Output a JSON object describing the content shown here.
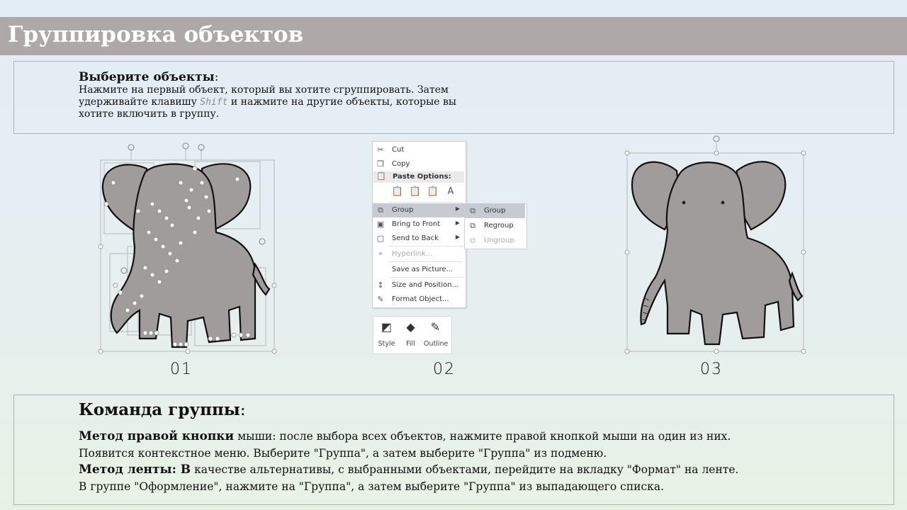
{
  "slide": {
    "title": "Группировка объектов"
  },
  "instructions": {
    "heading": "Выберите объекты",
    "colon": ":",
    "line1": "Нажмите на первый объект, который вы хотите сгруппировать. Затем",
    "line2_pre": "удерживайте клавишу ",
    "line2_key": "Shift",
    "line2_post": " и нажмите на другие объекты, которые вы",
    "line3": "хотите включить в группу."
  },
  "steps": {
    "step1": "01",
    "step2": "02",
    "step3": "03"
  },
  "context_menu": {
    "cut": "Cut",
    "copy": "Copy",
    "paste_options": "Paste Options:",
    "group": "Group",
    "bring_to_front": "Bring to Front",
    "send_to_back": "Send to Back",
    "hyperlink": "Hyperlink...",
    "save_as_picture": "Save as Picture...",
    "size_and_position": "Size and Position...",
    "format_object": "Format Object..."
  },
  "submenu": {
    "group": "Group",
    "regroup": "Regroup",
    "ungroup": "Ungroup"
  },
  "format_toolbar": {
    "style": "Style",
    "fill": "Fill",
    "outline": "Outline"
  },
  "command": {
    "heading": "Команда группы",
    "colon": ":",
    "m1_bold": "Метод правой кнопки",
    "m1_text": " мыши: после выбора всех объектов, нажмите правой кнопкой мыши на один из них.",
    "m1_line2": "Появится контекстное меню. Выберите \"Группа\", а затем выберите \"Группа\" из подменю.",
    "m2_bold": "Метод ленты: В",
    "m2_text": " качестве альтернативы, с выбранными объектами, перейдите на вкладку \"Формат\" на ленте.",
    "m2_line2": "В группе \"Оформление\", нажмите на \"Группа\", а затем выберите \"Группа\" из выпадающего списка."
  },
  "colors": {
    "title_bar": "#aea9a7",
    "elephant_fill": "#a19c9c",
    "menu_highlight": "#c7cbd1"
  },
  "icons": [
    "scissors-icon",
    "copy-icon",
    "paste-icon",
    "group-icon",
    "bring-front-icon",
    "send-back-icon",
    "hyperlink-icon",
    "size-position-icon",
    "format-object-icon",
    "style-icon",
    "fill-bucket-icon",
    "outline-pen-icon",
    "rotate-handle-icon"
  ]
}
